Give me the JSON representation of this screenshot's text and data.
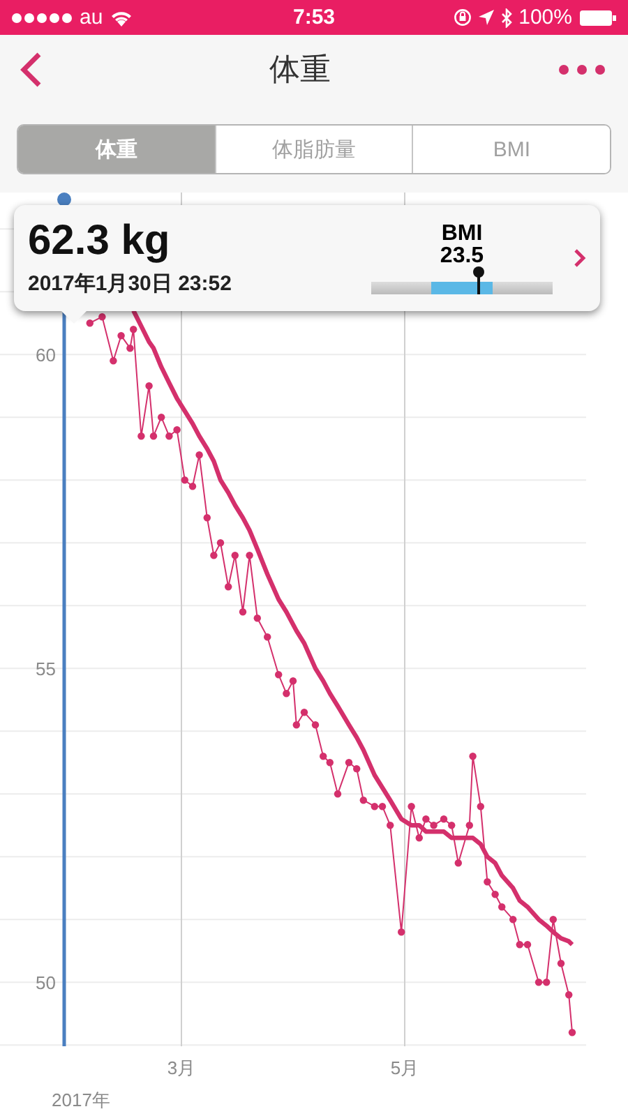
{
  "status_bar": {
    "carrier": "au",
    "time": "7:53",
    "battery": "100%"
  },
  "nav": {
    "title": "体重"
  },
  "tabs": [
    {
      "label": "体重",
      "selected": true
    },
    {
      "label": "体脂肪量",
      "selected": false
    },
    {
      "label": "BMI",
      "selected": false
    }
  ],
  "popup": {
    "weight": "62.3 kg",
    "date": "2017年1月30日 23:52",
    "bmi_label": "BMI",
    "bmi_value": "23.5",
    "level": 0.59
  },
  "chart": {
    "year_label": "2017年",
    "chart_data": {
      "type": "line",
      "x": [
        2.18,
        2.29,
        2.39,
        2.46,
        2.54,
        2.57,
        2.64,
        2.71,
        2.75,
        2.82,
        2.89,
        2.96,
        3.03,
        3.1,
        3.16,
        3.23,
        3.29,
        3.35,
        3.42,
        3.48,
        3.55,
        3.61,
        3.68,
        3.77,
        3.87,
        3.94,
        4.0,
        4.03,
        4.1,
        4.2,
        4.27,
        4.33,
        4.4,
        4.5,
        4.57,
        4.63,
        4.73,
        4.8,
        4.87,
        4.97,
        5.06,
        5.13,
        5.19,
        5.26,
        5.35,
        5.42,
        5.48,
        5.58,
        5.61,
        5.68,
        5.74,
        5.81,
        5.87,
        5.97,
        6.03,
        6.1,
        6.2,
        6.27,
        6.33,
        6.4,
        6.47,
        6.5
      ],
      "series": [
        {
          "color": "#d4306c",
          "marker": "circle",
          "values": [
            60.5,
            60.6,
            59.9,
            60.3,
            60.1,
            60.4,
            58.7,
            59.5,
            58.7,
            59.0,
            58.7,
            58.8,
            58.0,
            57.9,
            58.4,
            57.4,
            56.8,
            57.0,
            56.3,
            56.8,
            55.9,
            56.8,
            55.8,
            55.5,
            54.9,
            54.6,
            54.8,
            54.1,
            54.3,
            54.1,
            53.6,
            53.5,
            53.0,
            53.5,
            53.4,
            52.9,
            52.8,
            52.8,
            52.5,
            50.8,
            52.8,
            52.3,
            52.6,
            52.5,
            52.6,
            52.5,
            51.9,
            52.5,
            53.6,
            52.8,
            51.6,
            51.4,
            51.2,
            51.0,
            50.6,
            50.6,
            50.0,
            50.0,
            51.0,
            50.3,
            49.8,
            49.2
          ]
        },
        {
          "color": "#d4306c",
          "values": [
            null,
            null,
            null,
            null,
            null,
            60.7,
            60.45,
            60.2,
            60.1,
            59.8,
            59.55,
            59.3,
            59.1,
            58.9,
            58.7,
            58.5,
            58.3,
            58.0,
            57.8,
            57.6,
            57.4,
            57.2,
            56.9,
            56.5,
            56.1,
            55.9,
            55.7,
            55.6,
            55.4,
            55.0,
            54.8,
            54.6,
            54.4,
            54.1,
            53.9,
            53.7,
            53.3,
            53.1,
            52.9,
            52.6,
            52.5,
            52.5,
            52.4,
            52.4,
            52.4,
            52.3,
            52.3,
            52.3,
            52.3,
            52.2,
            52.0,
            51.9,
            51.7,
            51.5,
            51.3,
            51.2,
            51.0,
            50.9,
            50.8,
            50.7,
            50.65,
            50.6
          ]
        }
      ],
      "grid": true,
      "xlim": [
        1.375,
        6.625
      ],
      "ylim": [
        48.98,
        62.58
      ],
      "xticks": [
        {
          "value": 3,
          "label": "3月"
        },
        {
          "value": 5,
          "label": "5月"
        }
      ],
      "yticks": [
        50,
        55,
        60
      ]
    },
    "cursor": true
  }
}
